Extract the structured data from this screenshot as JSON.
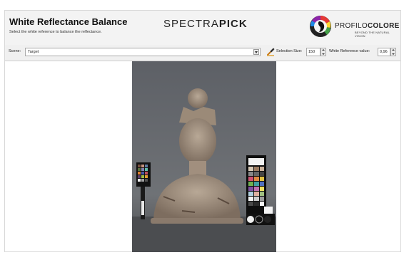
{
  "header": {
    "title": "White Reflectance Balance",
    "subtitle": "Select the white reference to balance the reflectance.",
    "brand_light": "SPECTRA",
    "brand_bold": "PICK",
    "logo_light": "PROFILO",
    "logo_bold": "COLORE",
    "logo_tagline": "BEYOND THE NATURAL VISION"
  },
  "toolbar": {
    "scene_label": "Scene:",
    "scene_value": "Target",
    "picker_icon": "eyedropper-icon",
    "selection_size_label": "Selection Size:",
    "selection_size_value": "150",
    "white_ref_label": "White Reference value:",
    "white_ref_value": "0,96"
  },
  "viewer": {
    "image": "statue-with-color-targets"
  }
}
